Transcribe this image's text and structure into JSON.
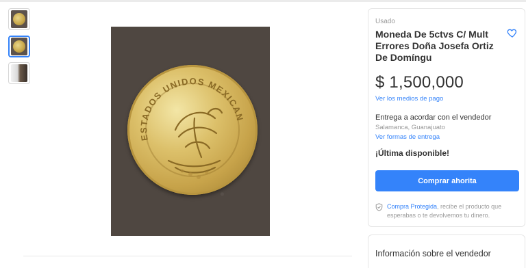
{
  "gallery": {
    "thumbnails": [
      {
        "name": "coin-front-thumb"
      },
      {
        "name": "coin-eagle-thumb",
        "selected": true
      },
      {
        "name": "coin-side-thumb"
      }
    ],
    "photo_alt": "coin photo",
    "coin_text": "ESTADOS UNIDOS MEXICANOS"
  },
  "product": {
    "condition": "Usado",
    "title": "Moneda De 5ctvs C/ Mult Errores Doña Josefa Ortiz De Domíngu",
    "price": "$ 1,500,000",
    "payment_link": "Ver los medios de pago",
    "delivery": "Entrega a acordar con el vendedor",
    "location": "Salamanca, Guanajuato",
    "delivery_link": "Ver formas de entrega",
    "stock": "¡Última disponible!",
    "buy_button": "Comprar ahorita",
    "protection_link": "Compra Protegida",
    "protection_text": ", recibe el producto que esperabas o te devolvemos tu dinero.",
    "favorite_icon": "heart-icon"
  },
  "seller": {
    "title": "Información sobre el vendedor"
  },
  "colors": {
    "accent": "#3483fa",
    "text": "#333333",
    "muted": "#999999"
  }
}
